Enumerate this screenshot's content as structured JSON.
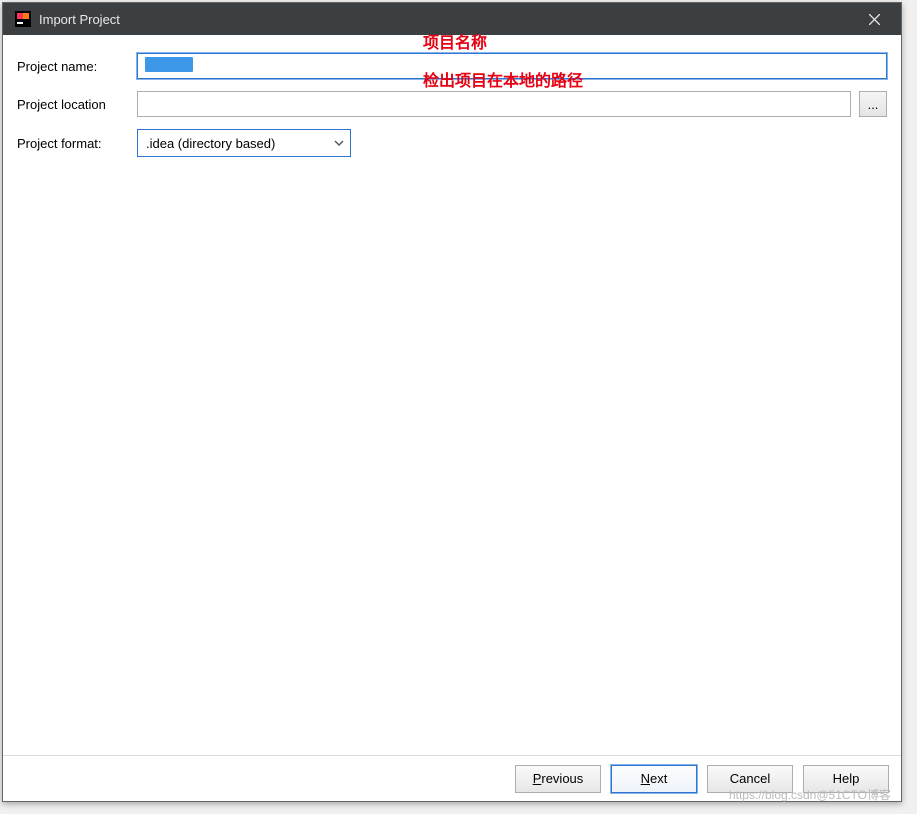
{
  "titlebar": {
    "title": "Import Project"
  },
  "form": {
    "name_label": "Project name:",
    "name_value": "",
    "location_label": "Project location",
    "location_value": "",
    "format_label": "Project format:",
    "format_value": ".idea (directory based)",
    "browse_label": "..."
  },
  "annotations": {
    "name_hint": "项目名称",
    "location_hint": "检出项目在本地的路径"
  },
  "buttons": {
    "previous": "Previous",
    "next": "Next",
    "cancel": "Cancel",
    "help": "Help"
  },
  "watermark": "https://blog.csdn@51CTO博客"
}
